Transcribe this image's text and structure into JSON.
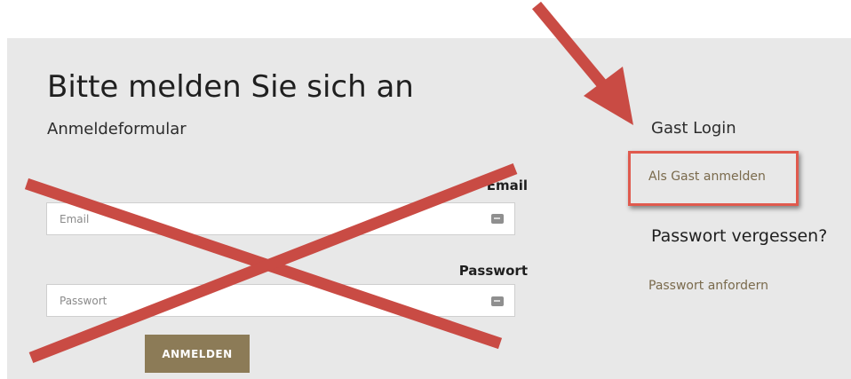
{
  "login": {
    "title": "Bitte melden Sie sich an",
    "subtitle": "Anmeldeformular",
    "email_label": "Email",
    "email_placeholder": "Email",
    "password_label": "Passwort",
    "password_placeholder": "Passwort",
    "submit_label": "ANMELDEN"
  },
  "guest": {
    "heading": "Gast Login",
    "link_label": "Als Gast anmelden"
  },
  "forgot": {
    "heading": "Passwort vergessen?",
    "link_label": "Passwort anfordern"
  },
  "annotations": {
    "cross_color": "#c94b44",
    "arrow_color": "#c94b44",
    "highlight_color": "#e05a4e"
  },
  "colors": {
    "panel_bg": "#e8e8e8",
    "button_bg": "#8c7b57",
    "link_color": "#7a6a4c"
  }
}
